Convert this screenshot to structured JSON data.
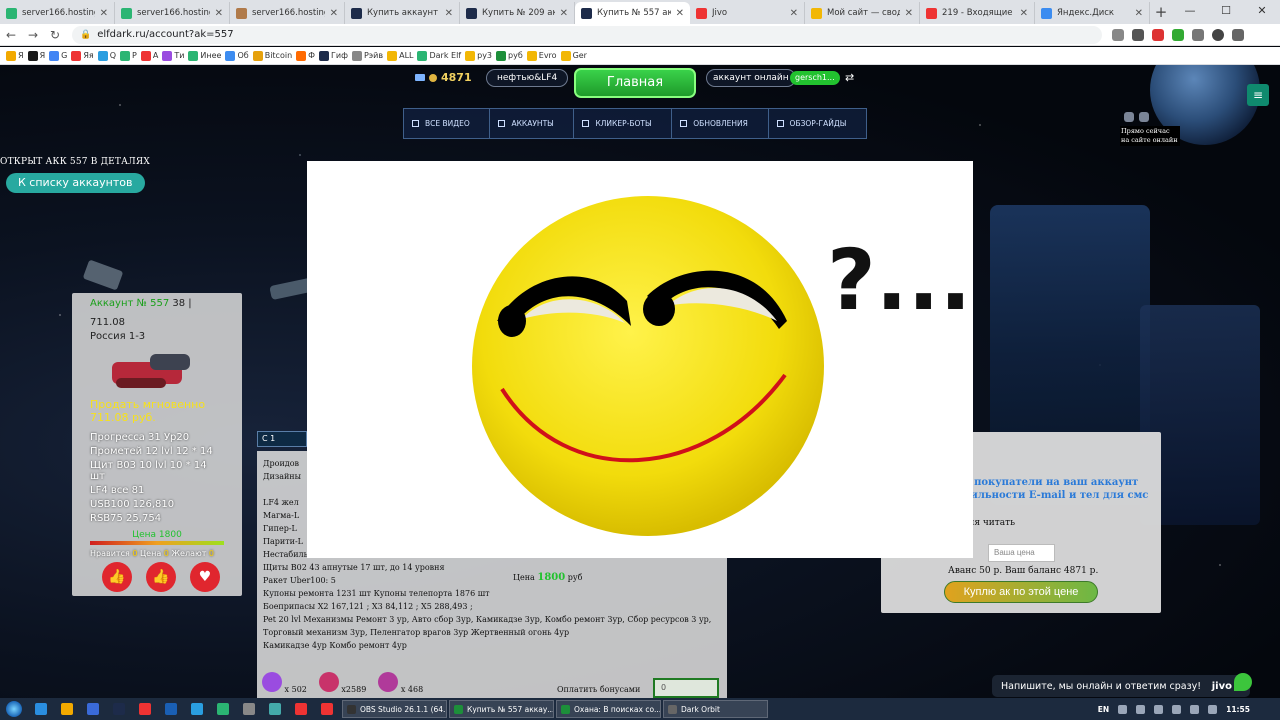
{
  "browser": {
    "tabs": [
      {
        "title": "server166.hosting.re",
        "color": "#2bb573",
        "active": false
      },
      {
        "title": "server166.hosting.re",
        "color": "#2bb573",
        "active": false
      },
      {
        "title": "server166.hosting.re",
        "color": "#b07a4a",
        "active": false
      },
      {
        "title": "Купить аккаунт в Da",
        "color": "#1d2b4a",
        "active": false
      },
      {
        "title": "Купить № 209 аккау",
        "color": "#1d2b4a",
        "active": false
      },
      {
        "title": "Купить № 557 аккау",
        "color": "#1d2b4a",
        "active": true
      },
      {
        "title": "Jivo",
        "color": "#e33",
        "active": false
      },
      {
        "title": "Мой сайт — сводк",
        "color": "#f2b705",
        "active": false
      },
      {
        "title": "219 - Входящие — Я",
        "color": "#e33",
        "active": false
      },
      {
        "title": "Яндекс.Диск",
        "color": "#3c8cf0",
        "active": false
      }
    ],
    "url": "elfdark.ru/account?ak=557",
    "bookmarks": [
      "Я",
      "Я",
      "G",
      "Яя",
      "Q",
      "Р",
      "А",
      "Ти",
      "Инее",
      "Об",
      "Bitcoin",
      "Ф",
      "Гиф",
      "Рэйв",
      "ALL",
      "Dark Elf",
      "ру3",
      "руб",
      "Evro",
      "Ger"
    ]
  },
  "header": {
    "currency_value": "4871",
    "user_label": "нефтью&LF4",
    "main_button": "Главная",
    "online_label": "аккаунт онлайн",
    "nickname": "gersch1..."
  },
  "nav": {
    "items": [
      "ВСЕ ВИДЕО",
      "АККАУНТЫ",
      "КЛИКЕР-БОТЫ",
      "ОБНОВЛЕНИЯ",
      "ОБЗОР-ГАЙДЫ"
    ]
  },
  "online_widget": {
    "label": "Прямо сейчас на сайте онлайн"
  },
  "page": {
    "detail_title": "ОТКРЫТ АКК 557 В ДЕТАЛЯХ",
    "back_button": "К списку аккаунтов"
  },
  "card": {
    "account_label": "Аккаунт № 557",
    "account_extra": "38 |",
    "level": "711.08",
    "server": "Россия 1-3",
    "sell_label": "Продать мгновенно",
    "sell_price": "711.08 руб.",
    "stats": [
      "Прогресса 31  Ур20",
      "Прометей 12  lvl 12 * 14",
      "Щит B03 10  lvl 10 * 14 шт",
      "LF4 все 81",
      "USB100 126,810",
      "RSB75 25,754"
    ],
    "price_label": "Цена 1800",
    "votes": {
      "likes_label": "Нравится",
      "likes": "0",
      "price_label": "Цена",
      "price": "0",
      "wants_label": "Желают",
      "wants": "0"
    }
  },
  "description": {
    "tab": "С 1",
    "lines": [
      "Дроидов",
      "Дизайны",
      "",
      "LF4 жел",
      "Магма-L",
      "Гипер-L",
      "Парити-L",
      "Нестабильная-6 - 6 шт LF4",
      "Щиты B02 43 апнутые 17 шт, до 14 уровня",
      "Ракет Uber100: 5",
      "Купоны ремонта 1231 шт Купоны телепорта 1876 шт",
      "Боеприпасы X2 167,121 ; X3 84,112 ; X5 288,493 ;",
      "Pet 20 lvl Механизмы Ремонт 3 ур, Авто сбор 3ур, Камикадзе 3ур, Комбо ремонт 3ур, Сбор ресурсов 3 ур, Торговый механизм 3ур, Пеленгатор врагов 3ур Жертвенный огонь 4ур",
      "Камикадзе 4ур Комбо ремонт 4ур"
    ],
    "price_prefix": "Цена",
    "price": "1800",
    "price_suffix": "руб",
    "items": [
      "x 502",
      "x2589",
      "x 468"
    ],
    "bonus_label": "Оплатить бонусами",
    "bonus_value": "0"
  },
  "buy_panel": {
    "line1": "ят покупатели на ваш аккаунт",
    "line2": "авильности E-mail и тел для смс",
    "line3": "ения читать",
    "price_placeholder": "Ваша цена",
    "balance": "Аванс 50 р. Ваш баланс 4871 р.",
    "buy_button": "Куплю ак по этой цене"
  },
  "popup": {
    "caption": "?..."
  },
  "chat": {
    "text": "Напишите, мы онлайн и ответим сразу!",
    "brand": "jivo"
  },
  "taskbar": {
    "tasks": [
      {
        "label": "OBS Studio 26.1.1 (64...",
        "color": "#333"
      },
      {
        "label": "Купить № 557 аккау...",
        "color": "#1d8f3a"
      },
      {
        "label": "Охана: В поисках со...",
        "color": "#1d8f3a"
      },
      {
        "label": "Dark Orbit",
        "color": "#666"
      }
    ],
    "lang": "EN",
    "time": "11:55"
  },
  "colors": {
    "accent_green": "#22c22f",
    "accent_teal": "#28a9a0",
    "link_blue": "#2a7ad8",
    "yellow": "#f6e11c"
  }
}
